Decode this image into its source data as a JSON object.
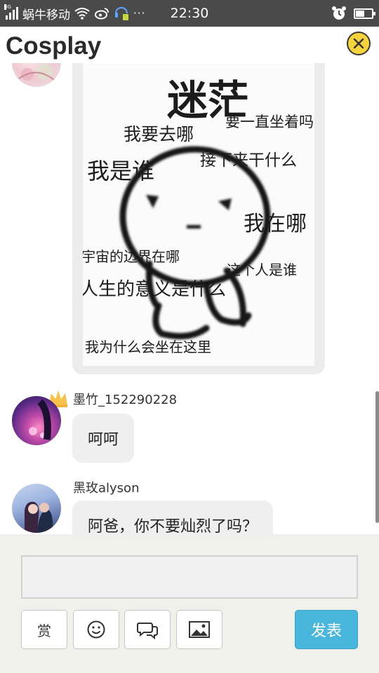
{
  "status_bar": {
    "carrier": "蜗牛移动",
    "network": "3G",
    "time": "22:30",
    "more": "···",
    "battery_level": 0.55
  },
  "header": {
    "title": "Cosplay",
    "accent_color": "#f5d33b"
  },
  "meme": {
    "title": "迷茫",
    "phrases": [
      "我要去哪",
      "要一直坐着吗",
      "接下来干什么",
      "我是谁",
      "我在哪",
      "宇宙的边界在哪",
      "这个人是谁",
      "人生的意义是什么",
      "我为什么会坐在这里"
    ]
  },
  "messages": [
    {
      "username": "墨竹_152290228",
      "text": "呵呵"
    },
    {
      "username": "黑玫alyson",
      "text": "阿爸，你不要灿烈了吗？"
    }
  ],
  "composer": {
    "input_value": "",
    "reward_label": "赏",
    "send_label": "发表",
    "send_color": "#49b7dc",
    "icons": [
      "smiley-icon",
      "chat-bubbles-icon",
      "image-icon"
    ]
  }
}
